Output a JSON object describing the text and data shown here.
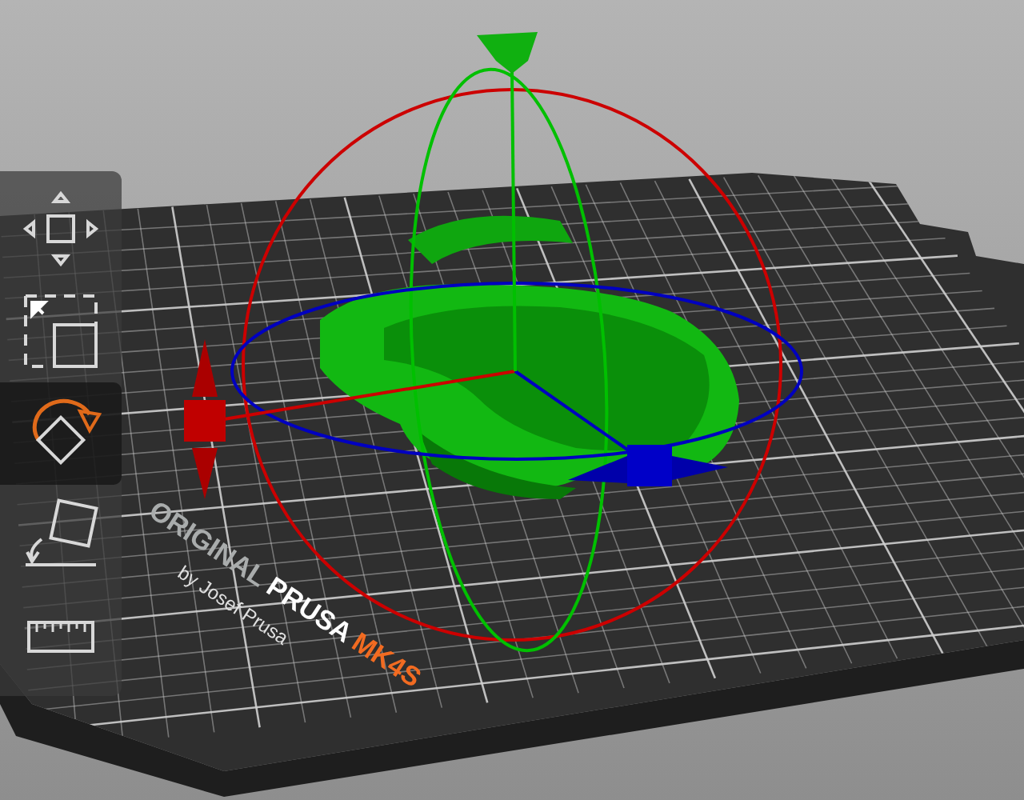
{
  "toolbar": {
    "tools": [
      {
        "kind": "move",
        "selected": false
      },
      {
        "kind": "scale",
        "selected": false
      },
      {
        "kind": "rotate",
        "selected": true
      },
      {
        "kind": "place",
        "selected": false
      },
      {
        "kind": "measure",
        "selected": false
      }
    ]
  },
  "bed": {
    "logo": [
      {
        "text": "ORIGINAL",
        "color": "#a9acac"
      },
      {
        "text": "PRUSA",
        "color": "#ffffff"
      },
      {
        "text": "MK4S",
        "color": "#f26b21"
      }
    ],
    "byline": "by Josef Prusa"
  }
}
